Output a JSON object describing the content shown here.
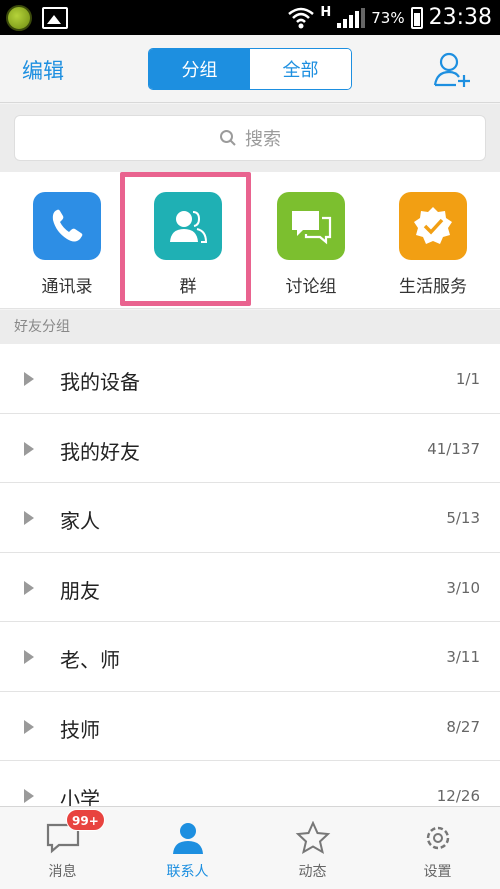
{
  "status_bar": {
    "network": "H",
    "battery": "73%",
    "time": "23:38"
  },
  "header": {
    "edit_label": "编辑",
    "segments": [
      "分组",
      "全部"
    ],
    "add_icon": "add-user-icon"
  },
  "search": {
    "placeholder": "搜索"
  },
  "apps": [
    {
      "label": "通讯录",
      "icon": "phone-icon",
      "color": "#2d8ee5"
    },
    {
      "label": "群",
      "icon": "group-icon",
      "color": "#1fb0b4"
    },
    {
      "label": "讨论组",
      "icon": "chat-icon",
      "color": "#7cbf2f"
    },
    {
      "label": "生活服务",
      "icon": "badge-check-icon",
      "color": "#f29f13"
    }
  ],
  "section_title": "好友分组",
  "groups": [
    {
      "name": "我的设备",
      "count": "1/1"
    },
    {
      "name": "我的好友",
      "count": "41/137"
    },
    {
      "name": "家人",
      "count": "5/13"
    },
    {
      "name": "朋友",
      "count": "3/10"
    },
    {
      "name": "老、师",
      "count": "3/11"
    },
    {
      "name": "技师",
      "count": "8/27"
    },
    {
      "name": "小学",
      "count": "12/26"
    }
  ],
  "tabs": [
    {
      "label": "消息",
      "icon": "message-icon",
      "badge": "99+"
    },
    {
      "label": "联系人",
      "icon": "contacts-icon"
    },
    {
      "label": "动态",
      "icon": "star-icon"
    },
    {
      "label": "设置",
      "icon": "gear-icon"
    }
  ],
  "colors": {
    "accent": "#1d8fe0",
    "highlight": "#e9638f",
    "badge": "#e8433f"
  }
}
